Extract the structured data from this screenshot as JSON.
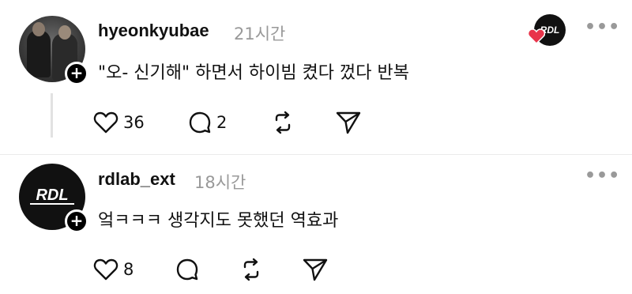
{
  "posts": [
    {
      "username": "hyeonkyubae",
      "time": "21시간",
      "text": "\"오- 신기해\" 하면서 하이빔 켰다 껐다 반복",
      "likes": "36",
      "comments": "2",
      "more": "•••",
      "avatar_icon": "profile-photo",
      "has_reply_indicator": true
    },
    {
      "username": "rdlab_ext",
      "time": "18시간",
      "text": "엌ㅋㅋㅋ 생각지도 못했던 역효과",
      "likes": "8",
      "comments": "",
      "more": "•••",
      "avatar_icon": "rdl-logo-icon"
    }
  ],
  "logo_text": "RDL",
  "colors": {
    "text": "#111111",
    "muted": "#999999",
    "heart": "#e8344a",
    "thread_line": "#e2e2e2"
  }
}
